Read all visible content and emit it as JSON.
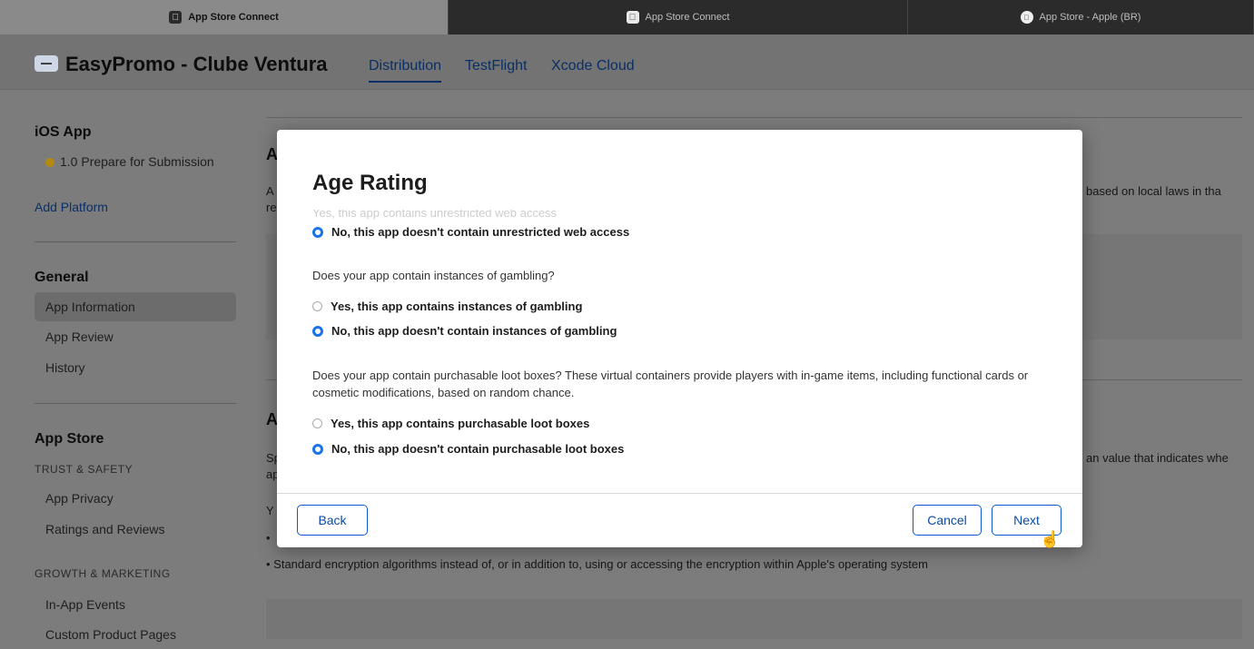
{
  "browser": {
    "tabs": [
      {
        "title": "App Store Connect",
        "icon": "apple-icon",
        "active": true
      },
      {
        "title": "App Store Connect",
        "icon": "apple-icon",
        "active": false
      },
      {
        "title": "App Store - Apple (BR)",
        "icon": "apple-icon",
        "active": false
      }
    ]
  },
  "header": {
    "app_name": "EasyPromo - Clube Ventura",
    "nav": [
      "Distribution",
      "TestFlight",
      "Xcode Cloud"
    ]
  },
  "sidebar": {
    "ios_heading": "iOS App",
    "version_status": "1.0 Prepare for Submission",
    "add_platform": "Add Platform",
    "general_heading": "General",
    "general_items": [
      "App Information",
      "App Review",
      "History"
    ],
    "appstore_heading": "App Store",
    "trust_caption": "TRUST & SAFETY",
    "trust_items": [
      "App Privacy",
      "Ratings and Reviews"
    ],
    "growth_caption": "GROWTH & MARKETING",
    "growth_items": [
      "In-App Events",
      "Custom Product Pages"
    ]
  },
  "background": {
    "section1_heading_letter": "A",
    "section1_line1": "A",
    "section1_line2": "re",
    "section1_right": "based on local laws in tha",
    "section2_heading_letter": "A",
    "section2_line1": "Sp",
    "section2_line2": "ap",
    "section2_right": "an value that indicates whe",
    "section2_yo": "Y",
    "bullet_1": "•",
    "bullet_2": "• Standard encryption algorithms instead of, or in addition to, using or accessing the encryption within Apple's operating system"
  },
  "modal": {
    "title": "Age Rating",
    "faded_option": "Yes, this app contains unrestricted web access",
    "web_access_no": "No, this app doesn't contain unrestricted web access",
    "gambling_question": "Does your app contain instances of gambling?",
    "gambling_yes": "Yes, this app contains instances of gambling",
    "gambling_no": "No, this app doesn't contain instances of gambling",
    "lootbox_question": "Does your app contain purchasable loot boxes? These virtual containers provide players with in-game items, including functional cards or cosmetic modifications, based on random chance.",
    "lootbox_yes": "Yes, this app contains purchasable loot boxes",
    "lootbox_no": "No, this app doesn't contain purchasable loot boxes",
    "buttons": {
      "back": "Back",
      "cancel": "Cancel",
      "next": "Next"
    }
  },
  "colors": {
    "accent": "#1a73e8",
    "link": "#0a4ba6"
  }
}
